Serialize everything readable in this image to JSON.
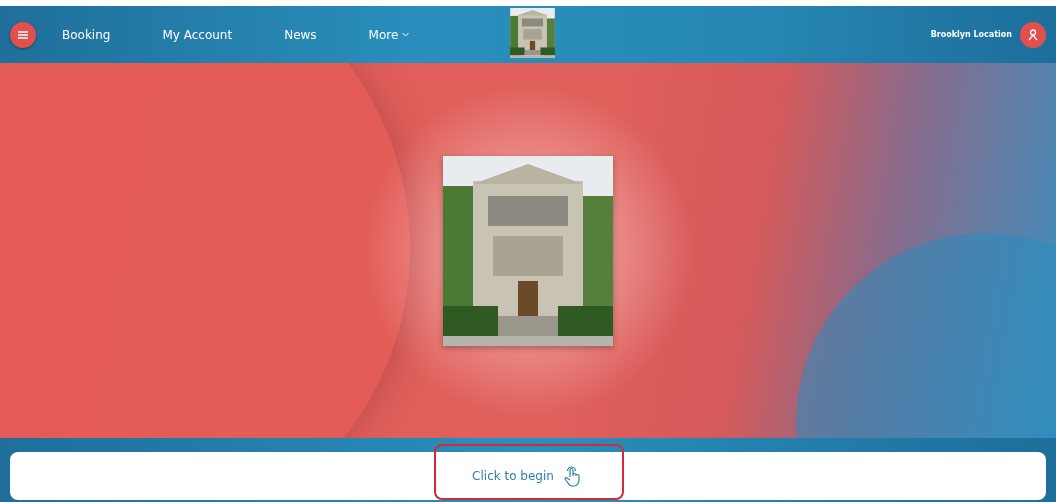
{
  "nav": {
    "items": [
      {
        "label": "Booking",
        "kind": "link"
      },
      {
        "label": "My Account",
        "kind": "link"
      },
      {
        "label": "News",
        "kind": "link"
      },
      {
        "label": "More",
        "kind": "dropdown"
      }
    ],
    "location": "Brooklyn Location"
  },
  "start": {
    "label": "Click to begin",
    "highlighted": true
  }
}
